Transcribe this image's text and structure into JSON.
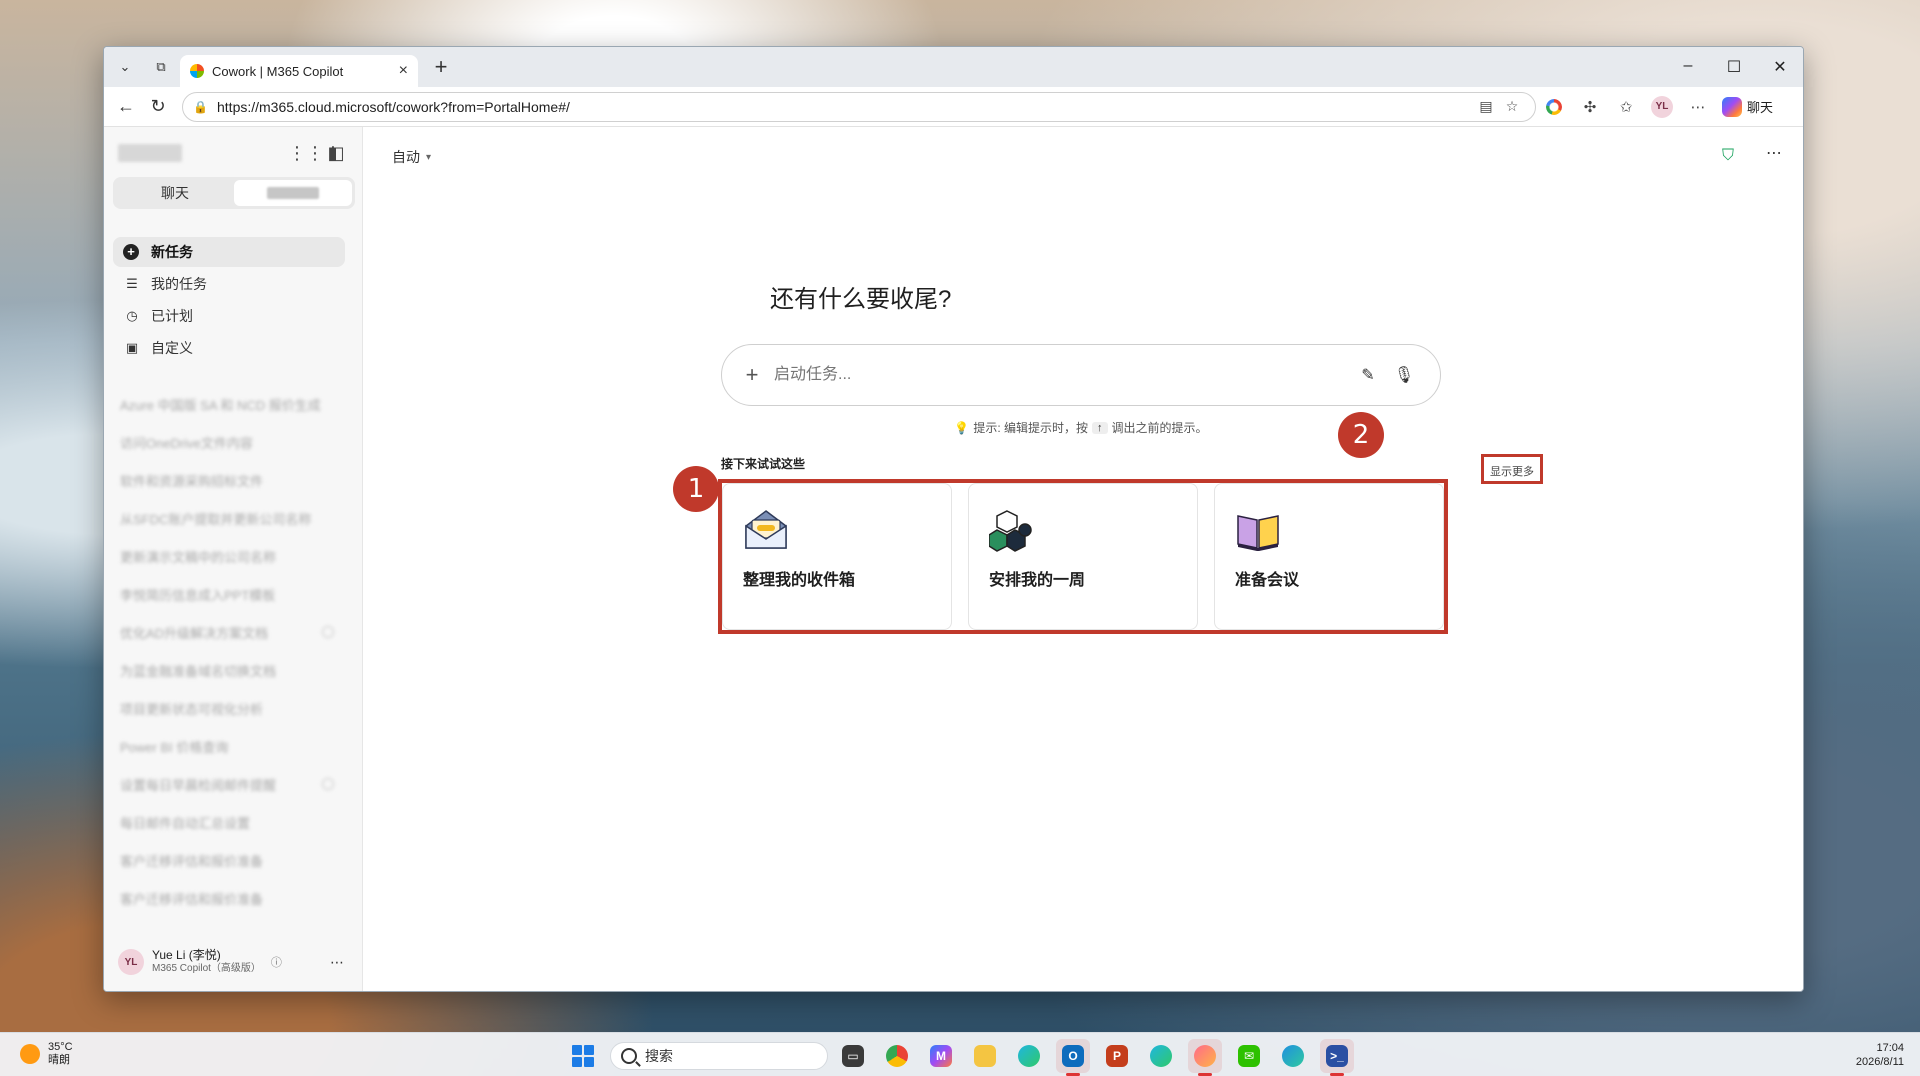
{
  "browser": {
    "tab_title": "Cowork | M365 Copilot",
    "url": "https://m365.cloud.microsoft/cowork?from=PortalHome#/",
    "profile_initials": "YL",
    "copilot_label": "聊天"
  },
  "sidebar": {
    "segments": [
      "聊天",
      ""
    ],
    "nav": [
      {
        "label": "新任务",
        "icon": "plus-circle-icon"
      },
      {
        "label": "我的任务",
        "icon": "list-icon"
      },
      {
        "label": "已计划",
        "icon": "clock-icon"
      },
      {
        "label": "自定义",
        "icon": "briefcase-icon"
      }
    ],
    "history": [
      "Azure 中国版 SA 和 NCD 报价生成",
      "访问OneDrive文件内容",
      "软件和资源采购招标文件",
      "从SFDC账户提取并更新公司名称",
      "更新演示文稿中的公司名称",
      "李悦简历信息成入PPT模板",
      "优化AD升级解决方案文档",
      "为蓝金融准备域名切换文档",
      "项目更新状态可视化分析",
      "Power BI 价格查询",
      "设置每日早晨检阅邮件提醒",
      "每日邮件自动汇总设置",
      "客户迁移评估和报价准备",
      "客户迁移评估和报价准备"
    ],
    "user": {
      "initials": "YL",
      "name": "Yue Li (李悦)",
      "plan": "M365 Copilot（高级版）"
    }
  },
  "main": {
    "mode_label": "自动",
    "headline": "还有什么要收尾?",
    "composer_placeholder": "启动任务...",
    "hint_prefix": "提示: 编辑提示时，按",
    "hint_key": "↑",
    "hint_suffix": "调出之前的提示。",
    "try_label": "接下来试试这些",
    "show_more": "显示更多",
    "cards": [
      {
        "label": "整理我的收件箱",
        "icon": "envelope-icon"
      },
      {
        "label": "安排我的一周",
        "icon": "cubes-icon"
      },
      {
        "label": "准备会议",
        "icon": "book-icon"
      }
    ]
  },
  "annotations": {
    "callout_1": "1",
    "callout_2": "2",
    "color": "#c0392b"
  },
  "taskbar": {
    "weather_temp": "35°C",
    "weather_desc": "晴朗",
    "search_label": "搜索",
    "time": "17:04",
    "date": "2026/8/11"
  }
}
